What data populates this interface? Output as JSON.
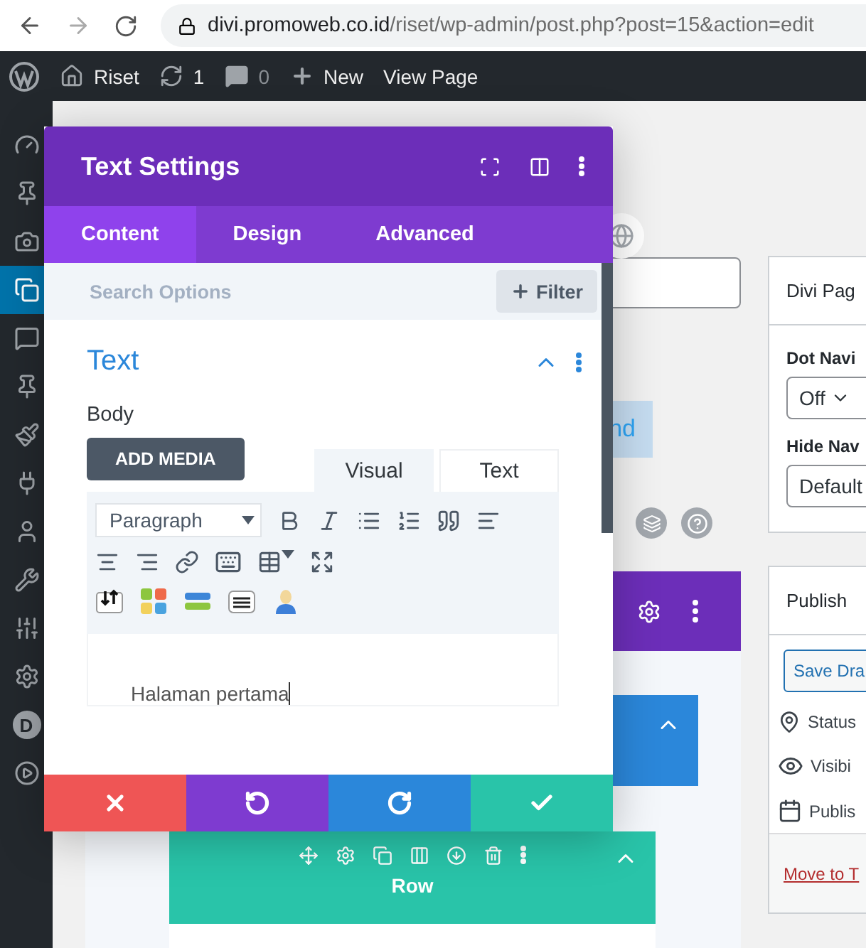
{
  "browser": {
    "url_host": "divi.promoweb.co.id",
    "url_path": "/riset/wp-admin/post.php?post=15&action=edit"
  },
  "admin_bar": {
    "site": "Riset",
    "updates": "1",
    "comments": "0",
    "new": "New",
    "view": "View Page"
  },
  "sidebar": {
    "items": [
      {
        "selected": false
      },
      {
        "selected": false
      },
      {
        "selected": false
      },
      {
        "selected": true
      },
      {
        "selected": false
      },
      {
        "selected": false
      },
      {
        "selected": false
      },
      {
        "selected": false
      },
      {
        "selected": false
      },
      {
        "selected": false
      },
      {
        "selected": false
      },
      {
        "selected": false
      },
      {
        "selected": false,
        "label": "D"
      },
      {
        "selected": false
      }
    ]
  },
  "page": {
    "partial_button": "nd",
    "row_label": "Row"
  },
  "divi_panel": {
    "title": "Divi Pag",
    "dot_nav_label": "Dot Navi",
    "dot_nav_value": "Off",
    "hide_nav_label": "Hide Nav",
    "hide_nav_value": "Default"
  },
  "publish_panel": {
    "title": "Publish",
    "save_button": "Save Dra",
    "status": "Status",
    "visibility": "Visibi",
    "publish": "Publis",
    "trash_link": "Move to T"
  },
  "settings_modal": {
    "title": "Text Settings",
    "tabs": [
      {
        "label": "Content",
        "selected": true
      },
      {
        "label": "Design",
        "selected": false
      },
      {
        "label": "Advanced",
        "selected": false
      }
    ],
    "search": {
      "placeholder": "Search Options"
    },
    "filter_button": "Filter",
    "section": {
      "title": "Text",
      "expanded": true
    },
    "body_label": "Body",
    "add_media": "ADD MEDIA",
    "editor_tabs": [
      {
        "label": "Visual",
        "selected": true
      },
      {
        "label": "Text",
        "selected": false
      }
    ],
    "format_select": "Paragraph",
    "content": "Halaman pertama",
    "actions": [
      {
        "kind": "cancel"
      },
      {
        "kind": "undo"
      },
      {
        "kind": "redo"
      },
      {
        "kind": "save"
      }
    ]
  }
}
